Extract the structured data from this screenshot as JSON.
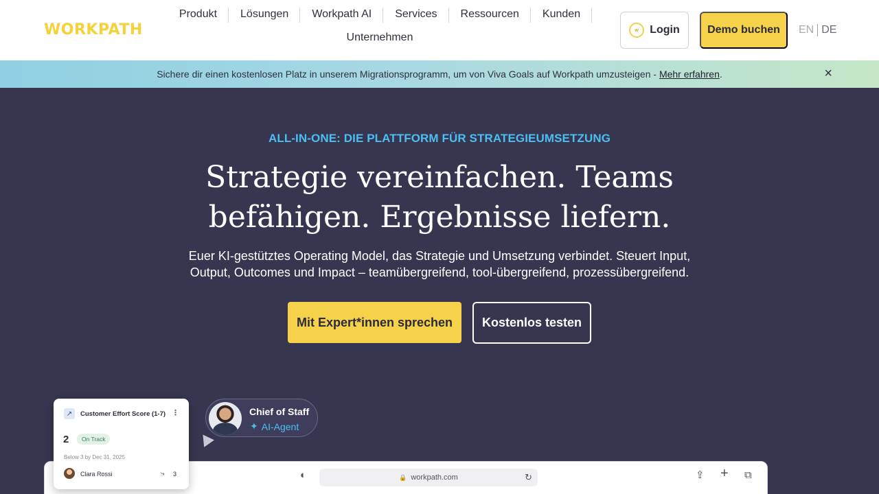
{
  "header": {
    "logo": "WORKPATH",
    "nav": [
      "Produkt",
      "Lösungen",
      "Workpath AI",
      "Services",
      "Ressourcen",
      "Kunden",
      "Unternehmen"
    ],
    "login_label": "Login",
    "login_icon_text": "w",
    "demo_label": "Demo buchen",
    "lang_en": "EN",
    "lang_de": "DE"
  },
  "banner": {
    "text": "Sichere dir einen kostenlosen Platz in unserem Migrationsprogramm, um von Viva Goals auf Workpath umzusteigen - ",
    "link": "Mehr erfahren",
    "suffix": ".",
    "close_icon": "×"
  },
  "hero": {
    "eyebrow": "ALL-IN-ONE: DIE PLATTFORM FÜR STRATEGIEUMSETZUNG",
    "headline": "Strategie vereinfachen. Teams befähigen. Ergebnisse liefern.",
    "subline": "Euer KI-gestütztes Operating Model, das Strategie und Umsetzung verbindet. Steuert Input, Output, Outcomes und Impact – teamübergreifend, tool-übergreifend, prozessübergreifend.",
    "cta_primary": "Mit Expert*innen sprechen",
    "cta_secondary": "Kostenlos testen"
  },
  "kpi_card": {
    "icon": "↗",
    "title": "Customer Effort Score (1-7)",
    "menu_icon": "⋮",
    "value": "2",
    "status": "On Track",
    "due": "Below 3 by Dec 31, 2025",
    "owner": "Clara Rossi",
    "links_icon": "⤷",
    "links_count": "3"
  },
  "agent": {
    "name": "Chief of Staff",
    "sparkle_icon": "✦",
    "role": "AI-Agent"
  },
  "browser": {
    "shield_icon": "◐",
    "lock_icon": "🔒",
    "url": "workpath.com",
    "reload_icon": "↻",
    "share_icon": "⇪",
    "plus_icon": "+",
    "tabs_icon": "⧉"
  },
  "colors": {
    "brand_yellow": "#f5d24a",
    "hero_bg": "#363651",
    "accent_blue": "#4dbef0"
  }
}
